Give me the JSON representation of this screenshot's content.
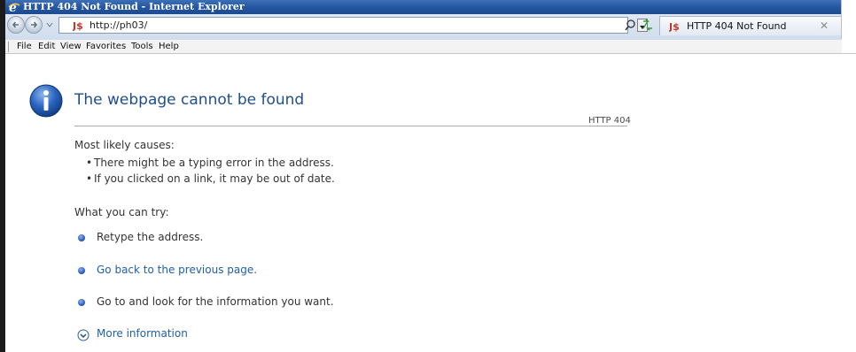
{
  "window": {
    "title": "HTTP 404 Not Found - Internet Explorer"
  },
  "address_bar": {
    "url": "http://ph03/"
  },
  "tab": {
    "label": "HTTP 404 Not Found"
  },
  "menu": [
    "File",
    "Edit",
    "View",
    "Favorites",
    "Tools",
    "Help"
  ],
  "page": {
    "title": "The webpage cannot be found",
    "code": "HTTP 404",
    "causes_heading": "Most likely causes:",
    "causes": [
      "There might be a typing error in the address.",
      "If you clicked on a link, it may be out of date."
    ],
    "try_heading": "What you can try:",
    "try_items": [
      "Retype the address.",
      "Go back to the previous page.",
      "Go to  and look for the information you want."
    ],
    "more_info": "More information"
  },
  "icons": {
    "app": "ie-logo-icon",
    "info": "info-icon",
    "site": "site-favicon-icon",
    "back": "back-arrow-icon",
    "forward": "forward-arrow-icon",
    "search": "search-icon",
    "compat": "compatibility-view-icon",
    "close": "close-icon",
    "expand": "chevron-down-icon"
  },
  "colors": {
    "title_blue": "#1f4e8c",
    "link_blue": "#1f5fa8",
    "titlebar": "#24559f"
  }
}
